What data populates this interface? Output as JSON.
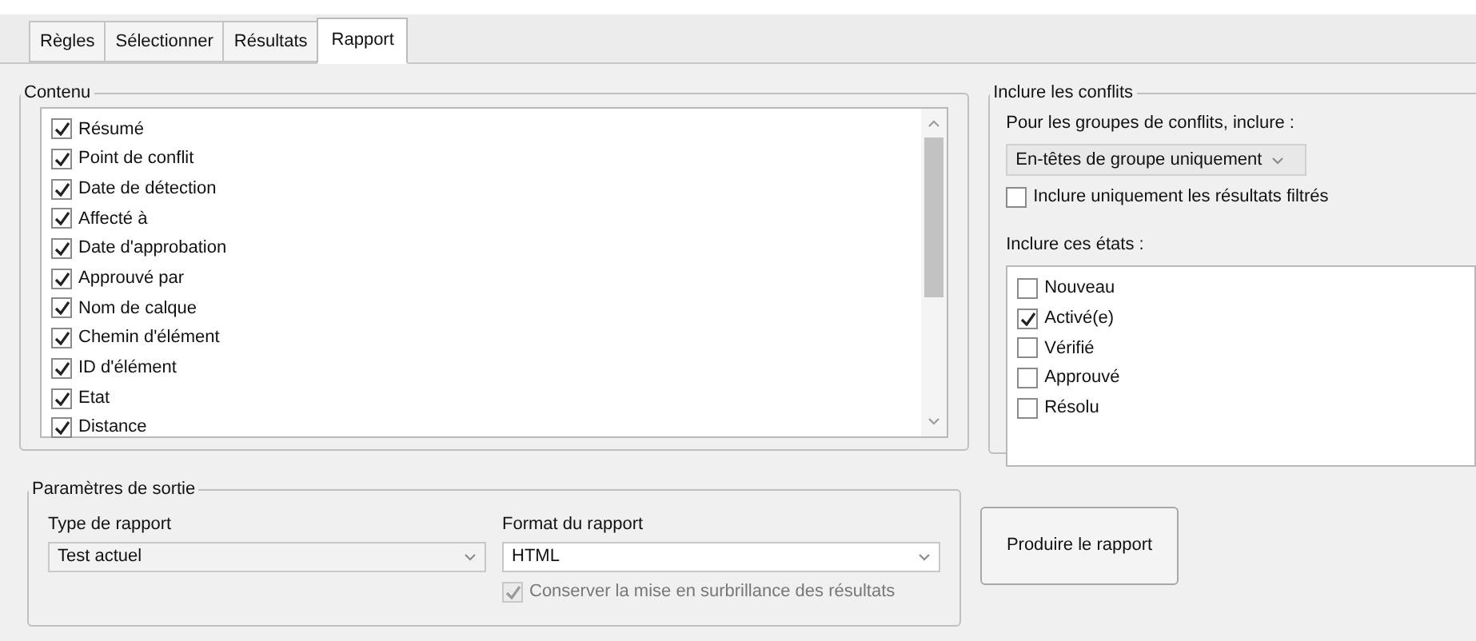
{
  "tabs": [
    {
      "label": "Règles",
      "selected": false
    },
    {
      "label": "Sélectionner",
      "selected": false
    },
    {
      "label": "Résultats",
      "selected": false
    },
    {
      "label": "Rapport",
      "selected": true
    }
  ],
  "contents": {
    "title": "Contenu",
    "items": [
      {
        "label": "Résumé",
        "checked": true
      },
      {
        "label": "Point de conflit",
        "checked": true
      },
      {
        "label": "Date de détection",
        "checked": true
      },
      {
        "label": "Affecté à",
        "checked": true
      },
      {
        "label": "Date d'approbation",
        "checked": true
      },
      {
        "label": "Approuvé par",
        "checked": true
      },
      {
        "label": "Nom de calque",
        "checked": true
      },
      {
        "label": "Chemin d'élément",
        "checked": true
      },
      {
        "label": "ID d'élément",
        "checked": true
      },
      {
        "label": "Etat",
        "checked": true
      },
      {
        "label": "Distance",
        "checked": true
      }
    ]
  },
  "include_conflicts": {
    "title": "Inclure les conflits",
    "groups_label": "Pour les groupes de conflits, inclure :",
    "groups_value": "En-têtes de groupe uniquement",
    "filtered_only": {
      "label": "Inclure uniquement les résultats filtrés",
      "checked": false
    },
    "states_label": "Inclure ces états :",
    "states": [
      {
        "label": "Nouveau",
        "checked": false
      },
      {
        "label": "Activé(e)",
        "checked": true
      },
      {
        "label": "Vérifié",
        "checked": false
      },
      {
        "label": "Approuvé",
        "checked": false
      },
      {
        "label": "Résolu",
        "checked": false
      }
    ]
  },
  "output": {
    "title": "Paramètres de sortie",
    "report_type_label": "Type de rapport",
    "report_type_value": "Test actuel",
    "report_format_label": "Format du rapport",
    "report_format_value": "HTML",
    "keep_highlight": {
      "label": "Conserver la mise en surbrillance des résultats",
      "checked": true,
      "disabled": true
    }
  },
  "produce_button": "Produire le rapport"
}
